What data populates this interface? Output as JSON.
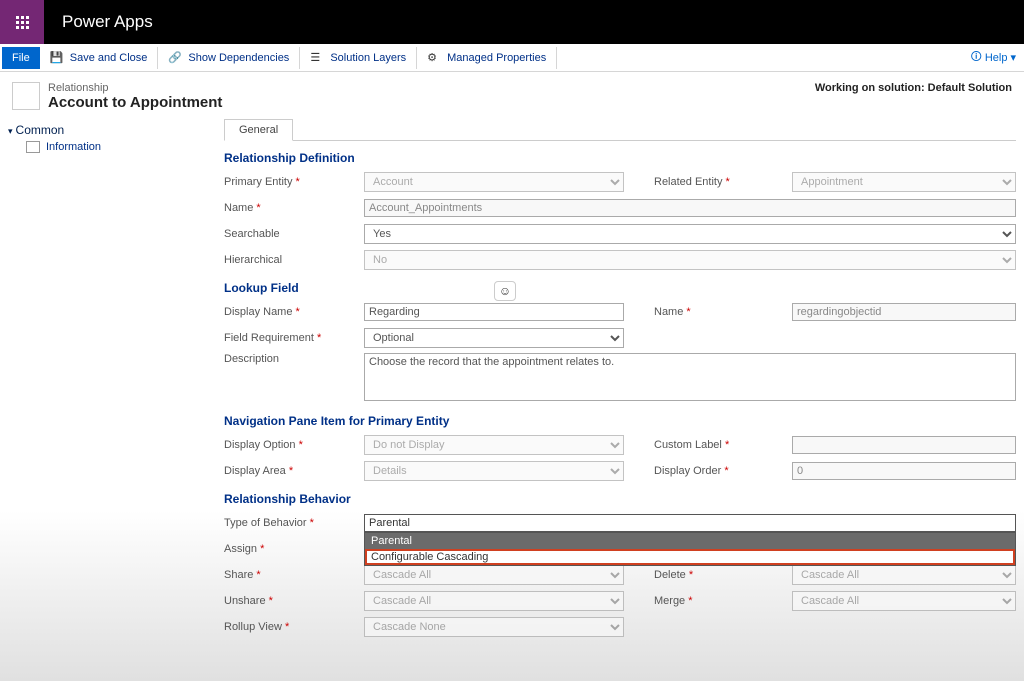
{
  "appTitle": "Power Apps",
  "toolbar": {
    "file": "File",
    "saveClose": "Save and Close",
    "showDeps": "Show Dependencies",
    "solLayers": "Solution Layers",
    "managedProps": "Managed Properties",
    "help": "Help"
  },
  "header": {
    "breadcrumb": "Relationship",
    "title": "Account to Appointment",
    "workingOn": "Working on solution: Default Solution"
  },
  "leftnav": {
    "group": "Common",
    "information": "Information"
  },
  "tabs": {
    "general": "General"
  },
  "sections": {
    "relDef": "Relationship Definition",
    "lookup": "Lookup Field",
    "navPane": "Navigation Pane Item for Primary Entity",
    "relBehavior": "Relationship Behavior"
  },
  "labels": {
    "primaryEntity": "Primary Entity",
    "relatedEntity": "Related Entity",
    "name": "Name",
    "searchable": "Searchable",
    "hierarchical": "Hierarchical",
    "displayName": "Display Name",
    "lookupName": "Name",
    "fieldReq": "Field Requirement",
    "description": "Description",
    "displayOption": "Display Option",
    "customLabel": "Custom Label",
    "displayArea": "Display Area",
    "displayOrder": "Display Order",
    "typeOfBehavior": "Type of Behavior",
    "assign": "Assign",
    "share": "Share",
    "delete": "Delete",
    "unshare": "Unshare",
    "merge": "Merge",
    "rollupView": "Rollup View"
  },
  "values": {
    "primaryEntity": "Account",
    "relatedEntity": "Appointment",
    "name": "Account_Appointments",
    "searchable": "Yes",
    "hierarchical": "No",
    "displayName": "Regarding",
    "lookupName": "regardingobjectid",
    "fieldReq": "Optional",
    "description": "Choose the record that the appointment relates to.",
    "displayOption": "Do not Display",
    "displayArea": "Details",
    "displayOrder": "0",
    "typeOfBehavior": "Parental",
    "share": "Cascade All",
    "delete": "Cascade All",
    "unshare": "Cascade All",
    "merge": "Cascade All",
    "rollupView": "Cascade None"
  },
  "behaviorOptions": {
    "parental": "Parental",
    "configurable": "Configurable Cascading"
  }
}
